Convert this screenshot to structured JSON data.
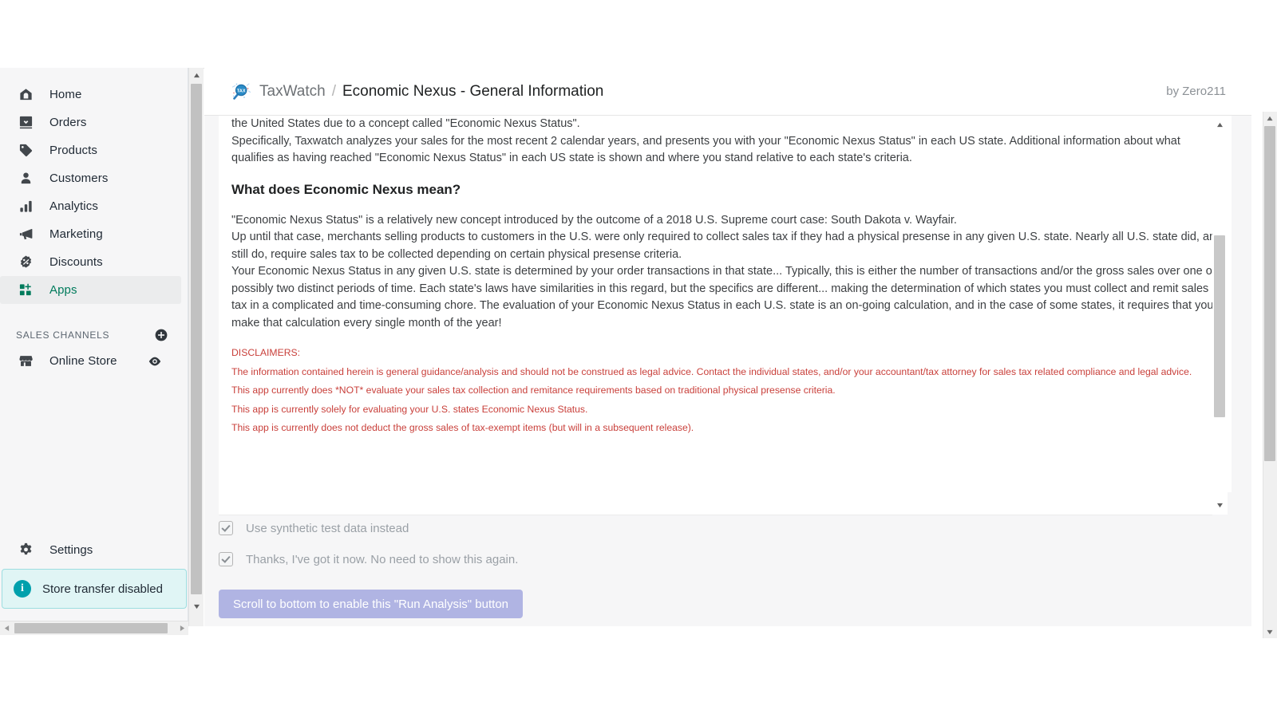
{
  "sidebar": {
    "items": [
      {
        "label": "Home",
        "icon": "home-icon",
        "active": false
      },
      {
        "label": "Orders",
        "icon": "orders-icon",
        "active": false
      },
      {
        "label": "Products",
        "icon": "tag-icon",
        "active": false
      },
      {
        "label": "Customers",
        "icon": "person-icon",
        "active": false
      },
      {
        "label": "Analytics",
        "icon": "bar-chart-icon",
        "active": false
      },
      {
        "label": "Marketing",
        "icon": "megaphone-icon",
        "active": false
      },
      {
        "label": "Discounts",
        "icon": "discount-icon",
        "active": false
      },
      {
        "label": "Apps",
        "icon": "apps-icon",
        "active": true
      }
    ],
    "section": {
      "label": "SALES CHANNELS",
      "add_icon": "plus-circle-icon"
    },
    "channels": [
      {
        "label": "Online Store",
        "icon": "store-icon",
        "action_icon": "eye-icon"
      }
    ],
    "settings": {
      "label": "Settings",
      "icon": "gear-icon"
    },
    "banner": {
      "label": "Store transfer disabled",
      "icon": "info-icon",
      "accent": "#00a0ac",
      "background": "#e0f5f5"
    }
  },
  "header": {
    "logo_icon": "taxwatch-magnifier-icon",
    "logo_text": "TAX",
    "app_name": "TaxWatch",
    "separator": "/",
    "page_title": "Economic Nexus - General Information",
    "byline": "by Zero211"
  },
  "content": {
    "intro_lines": [
      "the United States due to a concept called \"Economic Nexus Status\".",
      "Specifically, Taxwatch analyzes your sales for the most recent 2 calendar years, and presents you with your \"Economic Nexus Status\" in each US state. Additional information about what qualifies as having reached \"Economic Nexus Status\" in each US state is shown and where you stand relative to each state's criteria."
    ],
    "heading": "What does Economic Nexus mean?",
    "body_lines": [
      "\"Economic Nexus Status\" is a relatively new concept introduced by the outcome of a 2018 U.S. Supreme court case: South Dakota v. Wayfair.",
      "Up until that case, merchants selling products to customers in the U.S. were only required to collect sales tax if they had a physical presense in any given U.S. state. Nearly all U.S. state did, and still do, require sales tax to be collected depending on certain physical presense criteria.",
      "Your Economic Nexus Status in any given U.S. state is determined by your order transactions in that state... Typically, this is either the number of transactions and/or the gross sales over one or possibly two distinct periods of time. Each state's laws have similarities in this regard, but the specifics are different... making the determination of which states you must collect and remit sales tax in a complicated and time-consuming chore. The evaluation of your Economic Nexus Status in each U.S. state is an on-going calculation, and in the case of some states, it requires that you make that calculation every single month of the year!"
    ],
    "disclaimers_title": "DISCLAIMERS:",
    "disclaimers": [
      "The information contained herein is general guidance/analysis and should not be construed as legal advice. Contact the individual states, and/or your accountant/tax attorney for sales tax related compliance and legal advice.",
      "This app currently does *NOT* evaluate your sales tax collection and remitance requirements based on traditional physical presense criteria.",
      "This app is currently solely for evaluating your U.S. states Economic Nexus Status.",
      "This app is currently does not deduct the gross sales of tax-exempt items (but will in a subsequent release)."
    ],
    "disclaimer_color": "#c9403b"
  },
  "controls": {
    "checkbox_synthetic": {
      "label": "Use synthetic test data instead",
      "checked": true
    },
    "checkbox_ack": {
      "label": "Thanks, I've got it now. No need to show this again.",
      "checked": true
    },
    "run_button": {
      "label": "Scroll to bottom to enable this \"Run Analysis\" button",
      "disabled": true,
      "color": "#b0b4e3"
    }
  },
  "scrollbars": {
    "up_arrow": "▲",
    "down_arrow": "▼",
    "left_arrow": "◀",
    "right_arrow": "▶"
  }
}
